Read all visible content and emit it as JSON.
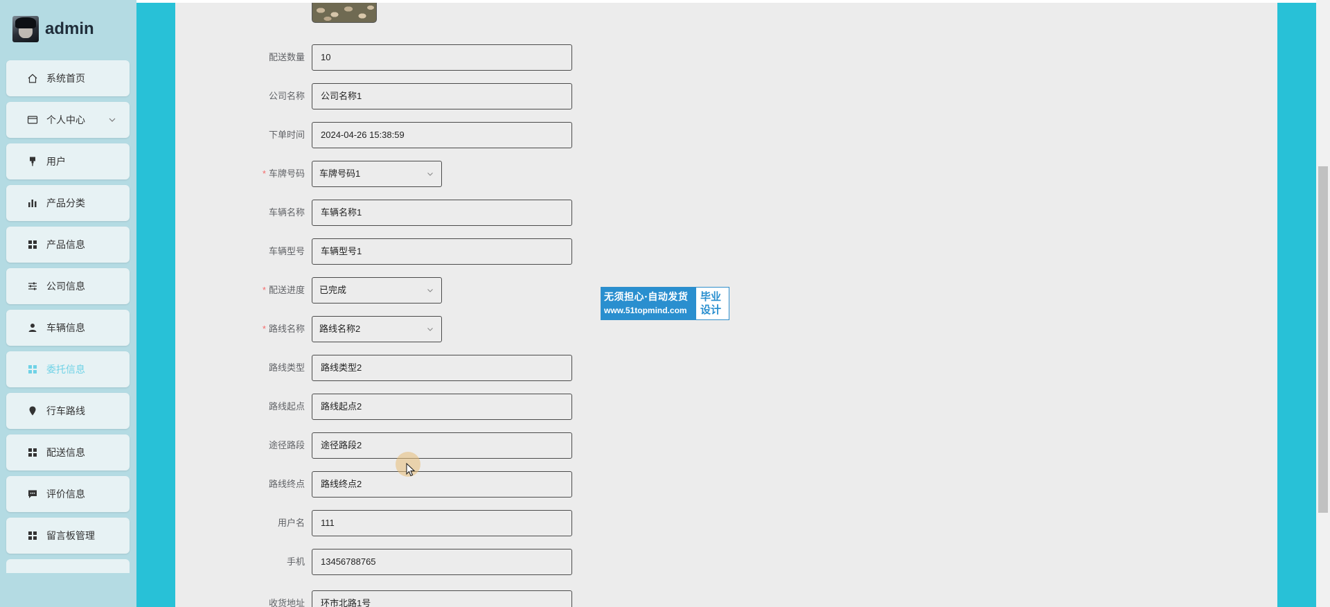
{
  "user": {
    "name": "admin"
  },
  "sidebar": {
    "items": [
      {
        "label": "系统首页",
        "icon": "home-icon"
      },
      {
        "label": "个人中心",
        "icon": "id-card-icon",
        "has_submenu": true
      },
      {
        "label": "用户",
        "icon": "pin-icon"
      },
      {
        "label": "产品分类",
        "icon": "bar-chart-icon"
      },
      {
        "label": "产品信息",
        "icon": "grid-icon"
      },
      {
        "label": "公司信息",
        "icon": "sliders-icon"
      },
      {
        "label": "车辆信息",
        "icon": "person-icon"
      },
      {
        "label": "委托信息",
        "icon": "grid-icon",
        "active": true
      },
      {
        "label": "行车路线",
        "icon": "location-pin-icon"
      },
      {
        "label": "配送信息",
        "icon": "grid-icon"
      },
      {
        "label": "评价信息",
        "icon": "chat-icon"
      },
      {
        "label": "留言板管理",
        "icon": "grid-icon"
      }
    ]
  },
  "form": {
    "fields": [
      {
        "label": "配送数量",
        "value": "10",
        "type": "input"
      },
      {
        "label": "公司名称",
        "value": "公司名称1",
        "type": "input"
      },
      {
        "label": "下单时间",
        "value": "2024-04-26 15:38:59",
        "type": "input"
      },
      {
        "label": "车牌号码",
        "value": "车牌号码1",
        "type": "select",
        "required": true
      },
      {
        "label": "车辆名称",
        "value": "车辆名称1",
        "type": "input"
      },
      {
        "label": "车辆型号",
        "value": "车辆型号1",
        "type": "input"
      },
      {
        "label": "配送进度",
        "value": "已完成",
        "type": "select",
        "required": true
      },
      {
        "label": "路线名称",
        "value": "路线名称2",
        "type": "select",
        "required": true
      },
      {
        "label": "路线类型",
        "value": "路线类型2",
        "type": "input"
      },
      {
        "label": "路线起点",
        "value": "路线起点2",
        "type": "input"
      },
      {
        "label": "途径路段",
        "value": "途径路段2",
        "type": "input"
      },
      {
        "label": "路线终点",
        "value": "路线终点2",
        "type": "input"
      },
      {
        "label": "用户名",
        "value": "111",
        "type": "input"
      },
      {
        "label": "手机",
        "value": "13456788765",
        "type": "input"
      },
      {
        "label": "收货地址",
        "value": "环市北路1号",
        "type": "input"
      }
    ],
    "required_mark": "*"
  },
  "watermark": {
    "line1": "无须担心·自动发货",
    "line2": "www.51topmind.com",
    "right_top": "毕业",
    "right_bottom": "设计"
  },
  "colors": {
    "sidebar_bg": "#b4dbe3",
    "accent_band": "#28c1d7",
    "content_bg": "#ececec",
    "active_menu": "#6fd2e6",
    "required": "#f56c6c"
  }
}
